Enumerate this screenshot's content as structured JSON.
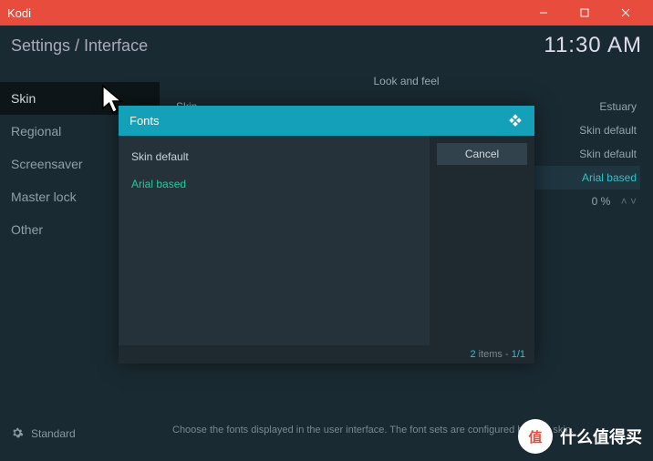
{
  "window": {
    "title": "Kodi"
  },
  "header": {
    "breadcrumb": "Settings / Interface",
    "clock": "11:30 AM"
  },
  "sidebar": {
    "items": [
      {
        "label": "Skin",
        "active": true
      },
      {
        "label": "Regional"
      },
      {
        "label": "Screensaver"
      },
      {
        "label": "Master lock"
      },
      {
        "label": "Other"
      }
    ]
  },
  "main": {
    "section": "Look and feel",
    "rows": [
      {
        "label": "Skin",
        "value": "Estuary"
      },
      {
        "label": "",
        "value": "Skin default"
      },
      {
        "label": "",
        "value": "Skin default"
      },
      {
        "label": "",
        "value": "Arial based",
        "hl": true
      },
      {
        "label": "",
        "value": "0 %",
        "stepper": true
      }
    ],
    "hint": "Choose the fonts displayed in the user interface. The font sets are configured by your skin."
  },
  "modal": {
    "title": "Fonts",
    "options": [
      {
        "label": "Skin default"
      },
      {
        "label": "Arial based",
        "selected": true
      }
    ],
    "cancel": "Cancel",
    "footer_count": "2",
    "footer_items": " items - ",
    "footer_page": "1/1"
  },
  "footer": {
    "level": "Standard"
  },
  "watermark": {
    "badge": "值",
    "text": "什么值得买"
  }
}
